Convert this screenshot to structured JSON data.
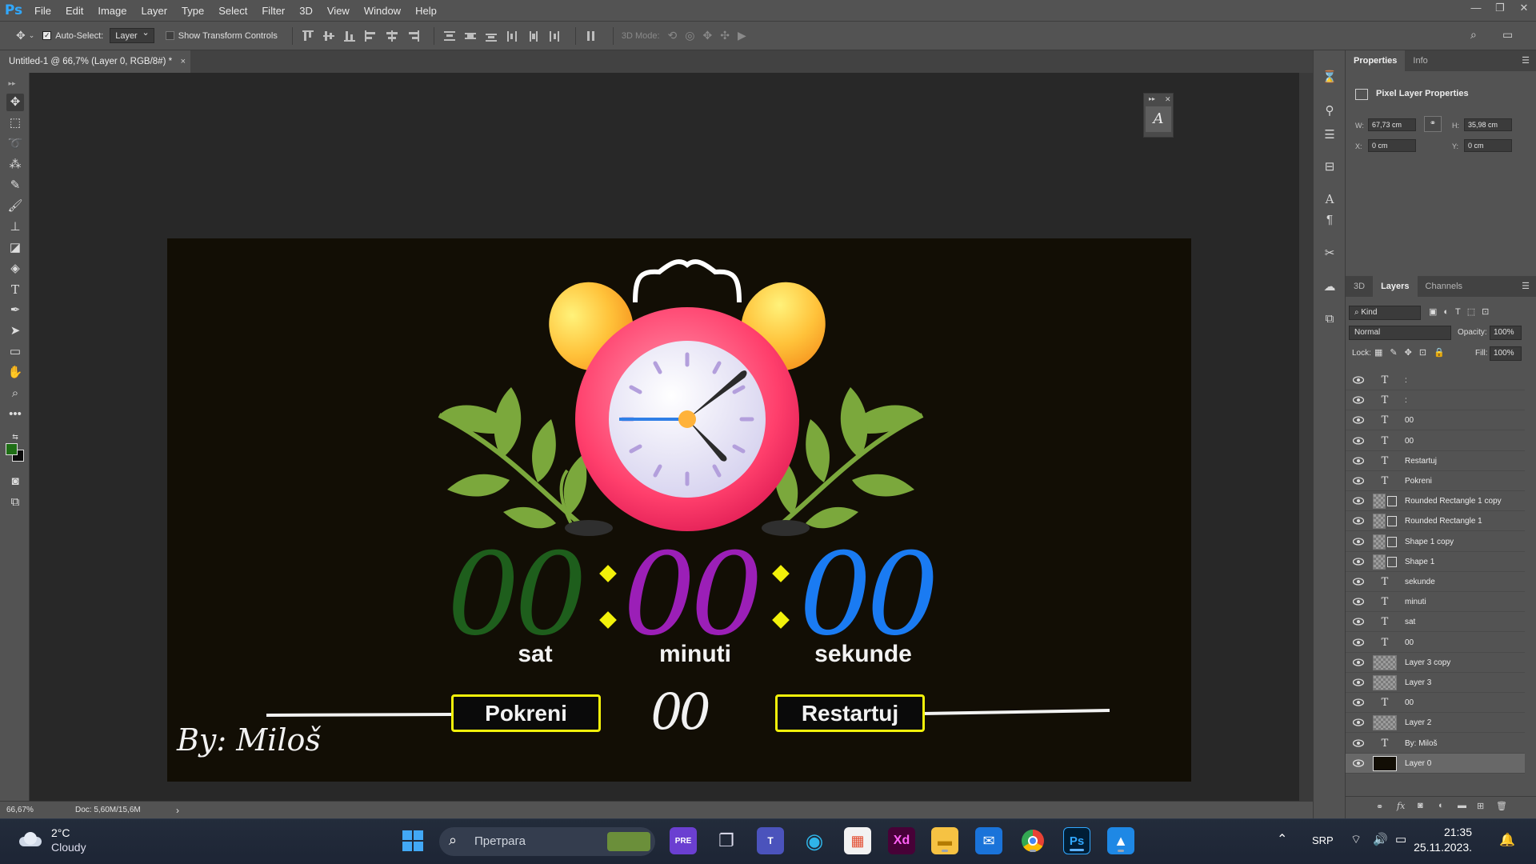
{
  "app": {
    "logo": "Ps"
  },
  "menu": [
    "File",
    "Edit",
    "Image",
    "Layer",
    "Type",
    "Select",
    "Filter",
    "3D",
    "View",
    "Window",
    "Help"
  ],
  "window_controls": [
    "—",
    "❐",
    "✕"
  ],
  "options_bar": {
    "auto_select_label": "Auto-Select:",
    "auto_select_checked": true,
    "auto_select_target": "Layer",
    "transform_label": "Show Transform Controls",
    "transform_checked": false,
    "mode_3d_label": "3D Mode:"
  },
  "document_tab": {
    "title": "Untitled-1 @ 66,7% (Layer 0, RGB/8#) *",
    "close": "×"
  },
  "canvas": {
    "labels": {
      "hours": "sat",
      "minutes": "minuti",
      "seconds": "sekunde"
    },
    "digits": {
      "hours": "00",
      "minutes": "00",
      "seconds": "00",
      "center": "00"
    },
    "colon": ":",
    "buttons": {
      "start": "Pokreni",
      "reset": "Restartuj"
    },
    "signature": "By: Miloš",
    "colors": {
      "hours": "#1e5e1c",
      "minutes": "#9b1fb7",
      "seconds": "#1a7bf2",
      "separator": "#f2f10a",
      "button_border": "#f2f10a",
      "background": "#120e05"
    }
  },
  "status_bar": {
    "zoom": "66,67%",
    "doc": "Doc: 5,60M/15,6M",
    "arrow": "›"
  },
  "properties": {
    "tabs": [
      "Properties",
      "Info"
    ],
    "heading": "Pixel Layer Properties",
    "w_label": "W:",
    "w": "67,73 cm",
    "h_label": "H:",
    "h": "35,98 cm",
    "x_label": "X:",
    "x": "0 cm",
    "y_label": "Y:",
    "y": "0 cm"
  },
  "layers_panel": {
    "tabs": [
      "3D",
      "Layers",
      "Channels"
    ],
    "filter": "Kind",
    "blend_mode": "Normal",
    "opacity_label": "Opacity:",
    "opacity": "100%",
    "lock_label": "Lock:",
    "fill_label": "Fill:",
    "fill": "100%",
    "layers": [
      {
        "name": ":",
        "kind": "text"
      },
      {
        "name": ":",
        "kind": "text"
      },
      {
        "name": "00",
        "kind": "text"
      },
      {
        "name": "00",
        "kind": "text"
      },
      {
        "name": "Restartuj",
        "kind": "text"
      },
      {
        "name": "Pokreni",
        "kind": "text"
      },
      {
        "name": "Rounded Rectangle 1 copy",
        "kind": "shape"
      },
      {
        "name": "Rounded Rectangle 1",
        "kind": "shape"
      },
      {
        "name": "Shape 1 copy",
        "kind": "shape"
      },
      {
        "name": "Shape 1",
        "kind": "shape"
      },
      {
        "name": "sekunde",
        "kind": "text"
      },
      {
        "name": "minuti",
        "kind": "text"
      },
      {
        "name": "sat",
        "kind": "text"
      },
      {
        "name": "00",
        "kind": "text"
      },
      {
        "name": "Layer 3 copy",
        "kind": "pixel"
      },
      {
        "name": "Layer 3",
        "kind": "pixel"
      },
      {
        "name": "00",
        "kind": "text"
      },
      {
        "name": "Layer 2",
        "kind": "pixel"
      },
      {
        "name": "By: Miloš",
        "kind": "text"
      },
      {
        "name": "Layer 0",
        "kind": "fill",
        "selected": true
      }
    ]
  },
  "taskbar": {
    "weather_temp": "2°C",
    "weather_desc": "Cloudy",
    "search_placeholder": "Претрага",
    "language": "SRP",
    "time": "21:35",
    "date": "25.11.2023."
  }
}
